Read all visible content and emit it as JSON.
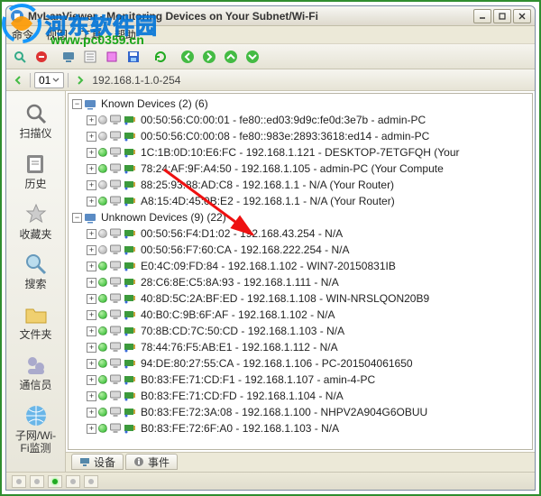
{
  "watermark": {
    "site_name": "河东软件园",
    "url": "www.pc0359.cn"
  },
  "window": {
    "title": "MyLanViewer - Monitoring Devices on Your Subnet/Wi-Fi"
  },
  "menu": {
    "cmd": "命令",
    "view": "视图",
    "tools": "工具",
    "help": "帮助"
  },
  "addressbar": {
    "text": "192.168.1-1.0-254",
    "chip": "01"
  },
  "sidebar": {
    "items": [
      {
        "label": "扫描仪"
      },
      {
        "label": "历史"
      },
      {
        "label": "收藏夹"
      },
      {
        "label": "搜索"
      },
      {
        "label": "文件夹"
      },
      {
        "label": "通信员"
      },
      {
        "label": "子网/Wi-Fi监测"
      }
    ]
  },
  "tree": {
    "known_header": "Known Devices (2) (6)",
    "unknown_header": "Unknown Devices (9) (22)",
    "known": [
      {
        "status": "gray",
        "text": "00:50:56:C0:00:01 - fe80::ed03:9d9c:fe0d:3e7b - admin-PC"
      },
      {
        "status": "gray",
        "text": "00:50:56:C0:00:08 - fe80::983e:2893:3618:ed14 - admin-PC"
      },
      {
        "status": "green",
        "text": "1C:1B:0D:10:E6:FC - 192.168.1.121 - DESKTOP-7ETGFQH (Your"
      },
      {
        "status": "green",
        "text": "78:24:AF:9F:A4:50 - 192.168.1.105 - admin-PC (Your Compute"
      },
      {
        "status": "gray",
        "text": "88:25:93:88:AD:C8 - 192.168.1.1 - N/A (Your Router)"
      },
      {
        "status": "green",
        "text": "A8:15:4D:45:0B:E2 - 192.168.1.1 - N/A (Your Router)"
      }
    ],
    "unknown": [
      {
        "status": "gray",
        "text": "00:50:56:F4:D1:02 - 192.168.43.254 - N/A"
      },
      {
        "status": "gray",
        "text": "00:50:56:F7:60:CA - 192.168.222.254 - N/A"
      },
      {
        "status": "green",
        "text": "E0:4C:09:FD:84 - 192.168.1.102 - WIN7-20150831IB"
      },
      {
        "status": "green",
        "text": "28:C6:8E:C5:8A:93 - 192.168.1.111 - N/A"
      },
      {
        "status": "green",
        "text": "40:8D:5C:2A:BF:ED - 192.168.1.108 - WIN-NRSLQON20B9"
      },
      {
        "status": "green",
        "text": "40:B0:C:9B:6F:AF - 192.168.1.102 - N/A"
      },
      {
        "status": "green",
        "text": "70:8B:CD:7C:50:CD - 192.168.1.103 - N/A"
      },
      {
        "status": "green",
        "text": "78:44:76:F5:AB:E1 - 192.168.1.112 - N/A"
      },
      {
        "status": "green",
        "text": "94:DE:80:27:55:CA - 192.168.1.106 - PC-201504061650"
      },
      {
        "status": "green",
        "text": "B0:83:FE:71:CD:F1 - 192.168.1.107 - amin-4-PC"
      },
      {
        "status": "green",
        "text": "B0:83:FE:71:CD:FD - 192.168.1.104 - N/A"
      },
      {
        "status": "green",
        "text": "B0:83:FE:72:3A:08 - 192.168.1.100 - NHPV2A904G6OBUU"
      },
      {
        "status": "green",
        "text": "B0:83:FE:72:6F:A0 - 192.168.1.103 - N/A"
      }
    ]
  },
  "bottom_tabs": {
    "devices": "设备",
    "events": "事件"
  },
  "colors": {
    "dot_green": "#2ab82a",
    "dot_gray": "#aaaaaa",
    "border": "#2f8d2f"
  }
}
